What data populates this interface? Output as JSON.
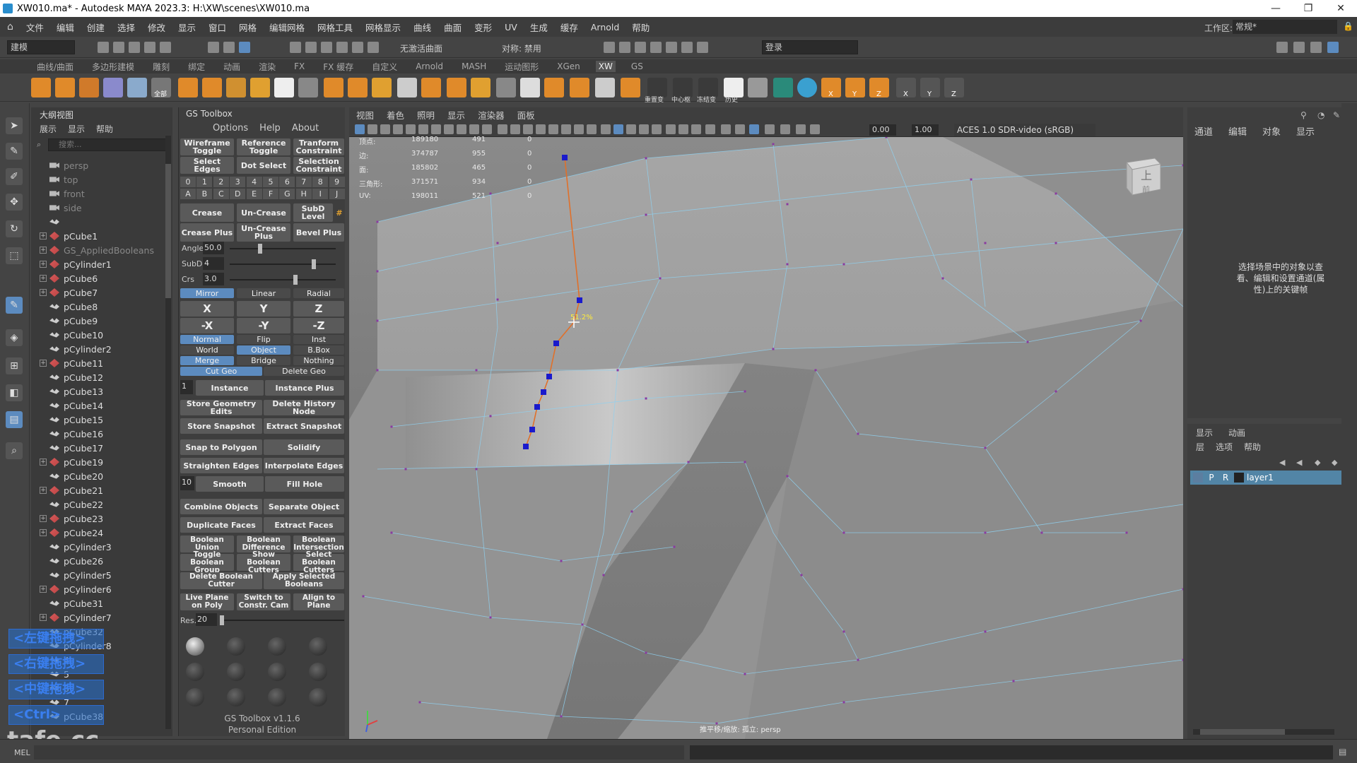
{
  "title": "XW010.ma* - Autodesk MAYA 2023.3: H:\\XW\\scenes\\XW010.ma",
  "window_buttons": {
    "minimize": "—",
    "maximize": "❐",
    "close": "✕"
  },
  "menubar": [
    "文件",
    "编辑",
    "创建",
    "选择",
    "修改",
    "显示",
    "窗口",
    "网格",
    "编辑网格",
    "网格工具",
    "网格显示",
    "曲线",
    "曲面",
    "变形",
    "UV",
    "生成",
    "缓存",
    "Arnold",
    "帮助"
  ],
  "status": {
    "mode": "建模",
    "live_surface": "无激活曲面",
    "symmetry": "对称: 禁用",
    "login": "登录",
    "workspace_label": "工作区:",
    "workspace": "常规*"
  },
  "shelf_tabs": [
    "曲线/曲面",
    "多边形建模",
    "雕刻",
    "绑定",
    "动画",
    "渲染",
    "FX",
    "FX 缓存",
    "自定义",
    "Arnold",
    "MASH",
    "运动图形",
    "XGen",
    "XW",
    "GS"
  ],
  "shelf_active": "XW",
  "shelf_labels": {
    "all": "全部",
    "reset": "重置变",
    "center": "中心枢",
    "freeze": "冻结变",
    "history": "历史",
    "x": "X",
    "y": "Y",
    "z": "Z"
  },
  "outliner": {
    "title": "大纲视图",
    "menu": [
      "展示",
      "显示",
      "帮助"
    ],
    "search_placeholder": "搜索...",
    "items": [
      {
        "label": "persp",
        "type": "cam",
        "expand": false,
        "dim": true
      },
      {
        "label": "top",
        "type": "cam",
        "expand": false,
        "dim": true
      },
      {
        "label": "front",
        "type": "cam",
        "expand": false,
        "dim": true
      },
      {
        "label": "side",
        "type": "cam",
        "expand": false,
        "dim": true
      },
      {
        "label": "",
        "type": "grp",
        "expand": false,
        "dim": true
      },
      {
        "label": "pCube1",
        "type": "mesh",
        "expand": true,
        "dim": false
      },
      {
        "label": "GS_AppliedBooleans",
        "type": "mesh",
        "expand": true,
        "dim": true
      },
      {
        "label": "pCylinder1",
        "type": "mesh",
        "expand": true,
        "dim": false
      },
      {
        "label": "pCube6",
        "type": "mesh",
        "expand": true,
        "dim": false
      },
      {
        "label": "pCube7",
        "type": "mesh",
        "expand": true,
        "dim": false
      },
      {
        "label": "pCube8",
        "type": "grp",
        "expand": false,
        "dim": false
      },
      {
        "label": "pCube9",
        "type": "grp",
        "expand": false,
        "dim": false
      },
      {
        "label": "pCube10",
        "type": "grp",
        "expand": false,
        "dim": false
      },
      {
        "label": "pCylinder2",
        "type": "grp",
        "expand": false,
        "dim": false
      },
      {
        "label": "pCube11",
        "type": "mesh",
        "expand": true,
        "dim": false
      },
      {
        "label": "pCube12",
        "type": "grp",
        "expand": false,
        "dim": false
      },
      {
        "label": "pCube13",
        "type": "grp",
        "expand": false,
        "dim": false
      },
      {
        "label": "pCube14",
        "type": "grp",
        "expand": false,
        "dim": false
      },
      {
        "label": "pCube15",
        "type": "grp",
        "expand": false,
        "dim": false
      },
      {
        "label": "pCube16",
        "type": "grp",
        "expand": false,
        "dim": false
      },
      {
        "label": "pCube17",
        "type": "grp",
        "expand": false,
        "dim": false
      },
      {
        "label": "pCube19",
        "type": "mesh",
        "expand": true,
        "dim": false
      },
      {
        "label": "pCube20",
        "type": "grp",
        "expand": false,
        "dim": false
      },
      {
        "label": "pCube21",
        "type": "mesh",
        "expand": true,
        "dim": false
      },
      {
        "label": "pCube22",
        "type": "grp",
        "expand": false,
        "dim": false
      },
      {
        "label": "pCube23",
        "type": "mesh",
        "expand": true,
        "dim": false
      },
      {
        "label": "pCube24",
        "type": "mesh",
        "expand": true,
        "dim": false
      },
      {
        "label": "pCylinder3",
        "type": "grp",
        "expand": false,
        "dim": false
      },
      {
        "label": "pCube26",
        "type": "grp",
        "expand": false,
        "dim": false
      },
      {
        "label": "pCylinder5",
        "type": "grp",
        "expand": false,
        "dim": false
      },
      {
        "label": "pCylinder6",
        "type": "mesh",
        "expand": true,
        "dim": false
      },
      {
        "label": "pCube31",
        "type": "grp",
        "expand": false,
        "dim": false
      },
      {
        "label": "pCylinder7",
        "type": "mesh",
        "expand": true,
        "dim": false
      },
      {
        "label": "pCube32",
        "type": "grp",
        "expand": false,
        "dim": false
      },
      {
        "label": "pCylinder8",
        "type": "grp",
        "expand": false,
        "dim": false
      },
      {
        "label": "4",
        "type": "grp",
        "expand": false,
        "dim": false
      },
      {
        "label": "5",
        "type": "grp",
        "expand": false,
        "dim": false
      },
      {
        "label": "6",
        "type": "grp",
        "expand": false,
        "dim": false
      },
      {
        "label": "7",
        "type": "grp",
        "expand": false,
        "dim": false
      },
      {
        "label": "pCube38",
        "type": "grp",
        "expand": false,
        "dim": false
      }
    ],
    "key_badges": [
      "<左键拖拽>",
      "<右键拖拽>",
      "<中键拖拽>",
      "<Ctrl>"
    ]
  },
  "watermark": "tafe.cc",
  "gs": {
    "title": "GS Toolbox",
    "menu": [
      "Options",
      "Help",
      "About"
    ],
    "wireframe": "Wireframe Toggle",
    "reference": "Reference Toggle",
    "transform": "Tranform Constraint",
    "select_edges": "Select Edges",
    "dot_select": "Dot Select",
    "selection_constraint": "Selection Constraint",
    "digits": [
      "0",
      "1",
      "2",
      "3",
      "4",
      "5",
      "6",
      "7",
      "8",
      "9"
    ],
    "letters": [
      "A",
      "B",
      "C",
      "D",
      "E",
      "F",
      "G",
      "H",
      "I",
      "J"
    ],
    "crease": "Crease",
    "uncrease": "Un-Crease",
    "subd_level": "SubD Level",
    "hash": "#",
    "crease_plus": "Crease Plus",
    "uncrease_plus": "Un-Crease Plus",
    "bevel_plus": "Bevel Plus",
    "angle_label": "Angle",
    "angle_value": "50.0",
    "subd_label": "SubD",
    "subd_value": "4",
    "crs_label": "Crs",
    "crs_value": "3.0",
    "mirror": "Mirror",
    "linear": "Linear",
    "radial": "Radial",
    "x": "X",
    "y": "Y",
    "z": "Z",
    "nx": "-X",
    "ny": "-Y",
    "nz": "-Z",
    "normal": "Normal",
    "flip": "Flip",
    "inst": "Inst",
    "world": "World",
    "object": "Object",
    "bbox": "B.Box",
    "merge": "Merge",
    "bridge": "Bridge",
    "nothing": "Nothing",
    "cut_geo": "Cut Geo",
    "delete_geo": "Delete Geo",
    "instance_count": "1",
    "instance": "Instance",
    "instance_plus": "Instance Plus",
    "store_geo": "Store Geometry Edits",
    "delete_history": "Delete History Node",
    "store_snapshot": "Store Snapshot",
    "extract_snapshot": "Extract Snapshot",
    "snap_polygon": "Snap to Polygon",
    "solidify": "Solidify",
    "straighten": "Straighten Edges",
    "interpolate": "Interpolate Edges",
    "smooth_count": "10",
    "smooth": "Smooth",
    "fill_hole": "Fill Hole",
    "combine": "Combine Objects",
    "separate": "Separate Object",
    "duplicate_faces": "Duplicate Faces",
    "extract_faces": "Extract Faces",
    "bool_union": "Boolean Union",
    "bool_diff": "Boolean Difference",
    "bool_inter": "Boolean Intersection",
    "toggle_bool": "Toggle Boolean Group",
    "show_cutters": "Show Boolean Cutters",
    "select_cutters": "Select Boolean Cutters",
    "delete_cutter": "Delete Boolean Cutter",
    "apply_bool": "Apply Selected Booleans",
    "live_plane": "Live Plane on Poly",
    "switch_cam": "Switch to Constr. Cam",
    "align_plane": "Align to Plane",
    "res_label": "Res.",
    "res_value": "20",
    "version": "GS Toolbox v1.1.6",
    "edition": "Personal Edition"
  },
  "viewport": {
    "menu": [
      "视图",
      "着色",
      "照明",
      "显示",
      "渲染器",
      "面板"
    ],
    "exposure": "0.00",
    "gamma": "1.00",
    "colorspace": "ACES 1.0 SDR-video (sRGB)",
    "hud": [
      {
        "label": "顶点:",
        "total": "189180",
        "sel": "491",
        "comp": "0"
      },
      {
        "label": "边:",
        "total": "374787",
        "sel": "955",
        "comp": "0"
      },
      {
        "label": "面:",
        "total": "185802",
        "sel": "465",
        "comp": "0"
      },
      {
        "label": "三角形:",
        "total": "371571",
        "sel": "934",
        "comp": "0"
      },
      {
        "label": "UV:",
        "total": "198011",
        "sel": "521",
        "comp": "0"
      }
    ],
    "slide_percent": "51.2%",
    "viewcube_top": "上",
    "viewcube_front": "前",
    "camera_label": "推平移/缩放: 孤立: persp"
  },
  "channel": {
    "menu": [
      "通道",
      "编辑",
      "对象",
      "显示"
    ],
    "message": "选择场景中的对象以查看、编辑和设置通道(属性)上的关键帧"
  },
  "layers": {
    "tabs": [
      "显示",
      "动画"
    ],
    "menu": [
      "层",
      "选项",
      "帮助"
    ],
    "row": {
      "p": "P",
      "r": "R",
      "name": "layer1"
    }
  },
  "bottom": {
    "mel": "MEL"
  },
  "colors": {
    "accent": "#5c8bbf",
    "vertex": "#1a1acc",
    "edge": "#e0702a"
  }
}
